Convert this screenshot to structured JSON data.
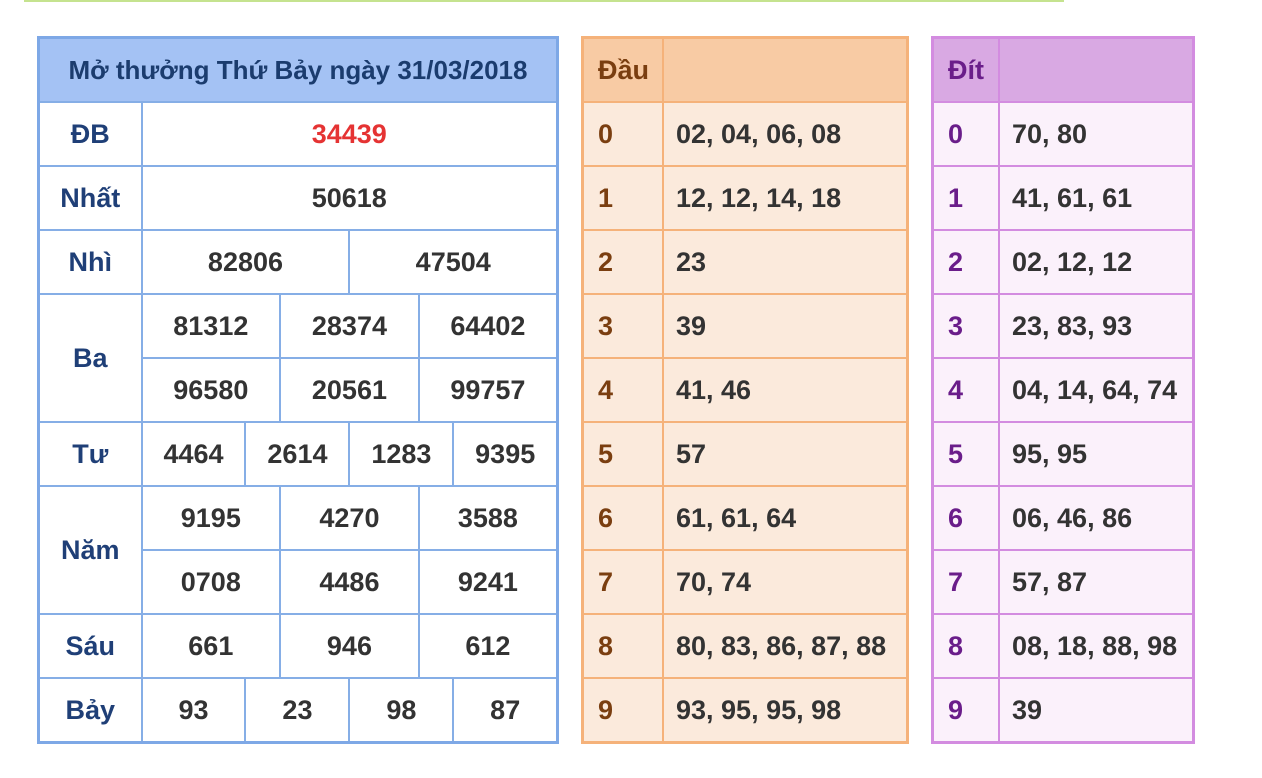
{
  "results": {
    "title": "Mở thưởng Thứ Bảy ngày 31/03/2018",
    "db": {
      "label": "ĐB",
      "numbers": [
        "34439"
      ]
    },
    "nhat": {
      "label": "Nhất",
      "numbers": [
        "50618"
      ]
    },
    "nhi": {
      "label": "Nhì",
      "numbers": [
        "82806",
        "47504"
      ]
    },
    "ba": {
      "label": "Ba",
      "numbers": [
        "81312",
        "28374",
        "64402",
        "96580",
        "20561",
        "99757"
      ]
    },
    "tu": {
      "label": "Tư",
      "numbers": [
        "4464",
        "2614",
        "1283",
        "9395"
      ]
    },
    "nam": {
      "label": "Năm",
      "numbers": [
        "9195",
        "4270",
        "3588",
        "0708",
        "4486",
        "9241"
      ]
    },
    "sau": {
      "label": "Sáu",
      "numbers": [
        "661",
        "946",
        "612"
      ]
    },
    "bay": {
      "label": "Bảy",
      "numbers": [
        "93",
        "23",
        "98",
        "87"
      ]
    },
    "special_color": "#e53333"
  },
  "dau": {
    "header": "Đầu",
    "rows": [
      {
        "key": "0",
        "values": "02, 04, 06, 08"
      },
      {
        "key": "1",
        "values": "12, 12, 14, 18"
      },
      {
        "key": "2",
        "values": "23"
      },
      {
        "key": "3",
        "values": "39"
      },
      {
        "key": "4",
        "values": "41, 46"
      },
      {
        "key": "5",
        "values": "57"
      },
      {
        "key": "6",
        "values": "61, 61, 64"
      },
      {
        "key": "7",
        "values": "70, 74"
      },
      {
        "key": "8",
        "values": "80, 83, 86, 87, 88"
      },
      {
        "key": "9",
        "values": "93, 95, 95, 98"
      }
    ]
  },
  "dit": {
    "header": "Đít",
    "rows": [
      {
        "key": "0",
        "values": "70, 80"
      },
      {
        "key": "1",
        "values": "41, 61, 61"
      },
      {
        "key": "2",
        "values": "02, 12, 12"
      },
      {
        "key": "3",
        "values": "23, 83, 93"
      },
      {
        "key": "4",
        "values": "04, 14, 64, 74"
      },
      {
        "key": "5",
        "values": "95, 95"
      },
      {
        "key": "6",
        "values": "06, 46, 86"
      },
      {
        "key": "7",
        "values": "57, 87"
      },
      {
        "key": "8",
        "values": "08, 18, 88, 98"
      },
      {
        "key": "9",
        "values": "39"
      }
    ]
  }
}
